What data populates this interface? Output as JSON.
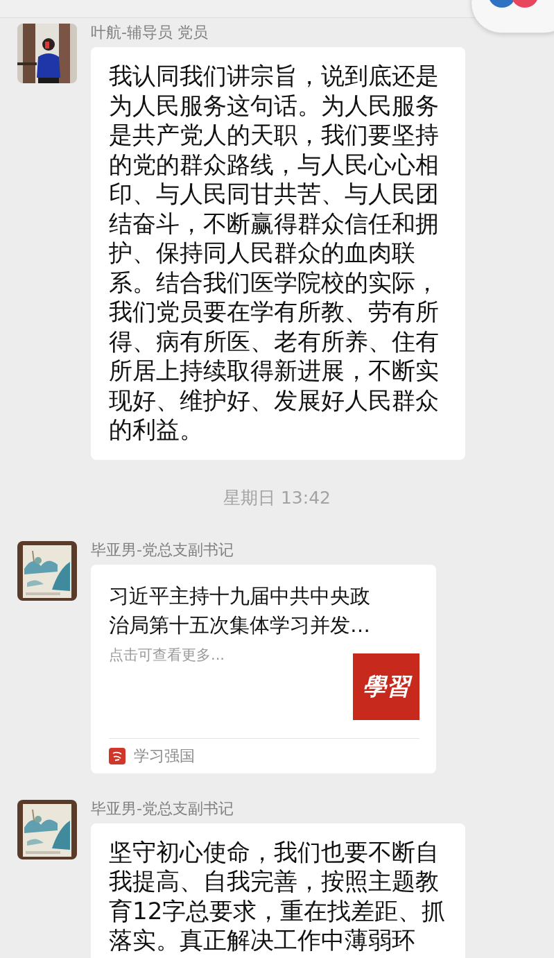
{
  "messages": [
    {
      "kind": "text",
      "sender": "叶航-辅导员 党员",
      "lines": [
        "我认同我们讲宗旨，说到底还是",
        "为人民服务这句话。为人民服务",
        "是共产党人的天职，我们要坚持",
        "的党的群众路线，与人民心心相",
        "印、与人民同甘共苦、与人民团",
        "结奋斗，不断赢得群众信任和拥",
        "护、保持同人民群众的血肉联",
        "系。结合我们医学院校的实际，",
        "我们党员要在学有所教、劳有所",
        "得、病有所医、老有所养、住有",
        "所居上持续取得新进展，不断实",
        "现好、维护好、发展好人民群众",
        "的利益。"
      ]
    },
    {
      "kind": "timestamp",
      "text": "星期日 13:42"
    },
    {
      "kind": "link_card",
      "sender": "毕亚男-党总支副书记",
      "title_lines": [
        "习近平主持十九届中共中央政",
        "治局第十五次集体学习并发…"
      ],
      "description": "点击可查看更多...",
      "thumbnail_text": "學習",
      "source": "学习强国"
    },
    {
      "kind": "text",
      "sender": "毕亚男-党总支副书记",
      "lines": [
        "坚守初心使命，我们也要不断自",
        "我提高、自我完善，按照主题教",
        "育12字总要求，重在找差距、抓",
        "落实。真正解决工作中薄弱环"
      ]
    }
  ]
}
